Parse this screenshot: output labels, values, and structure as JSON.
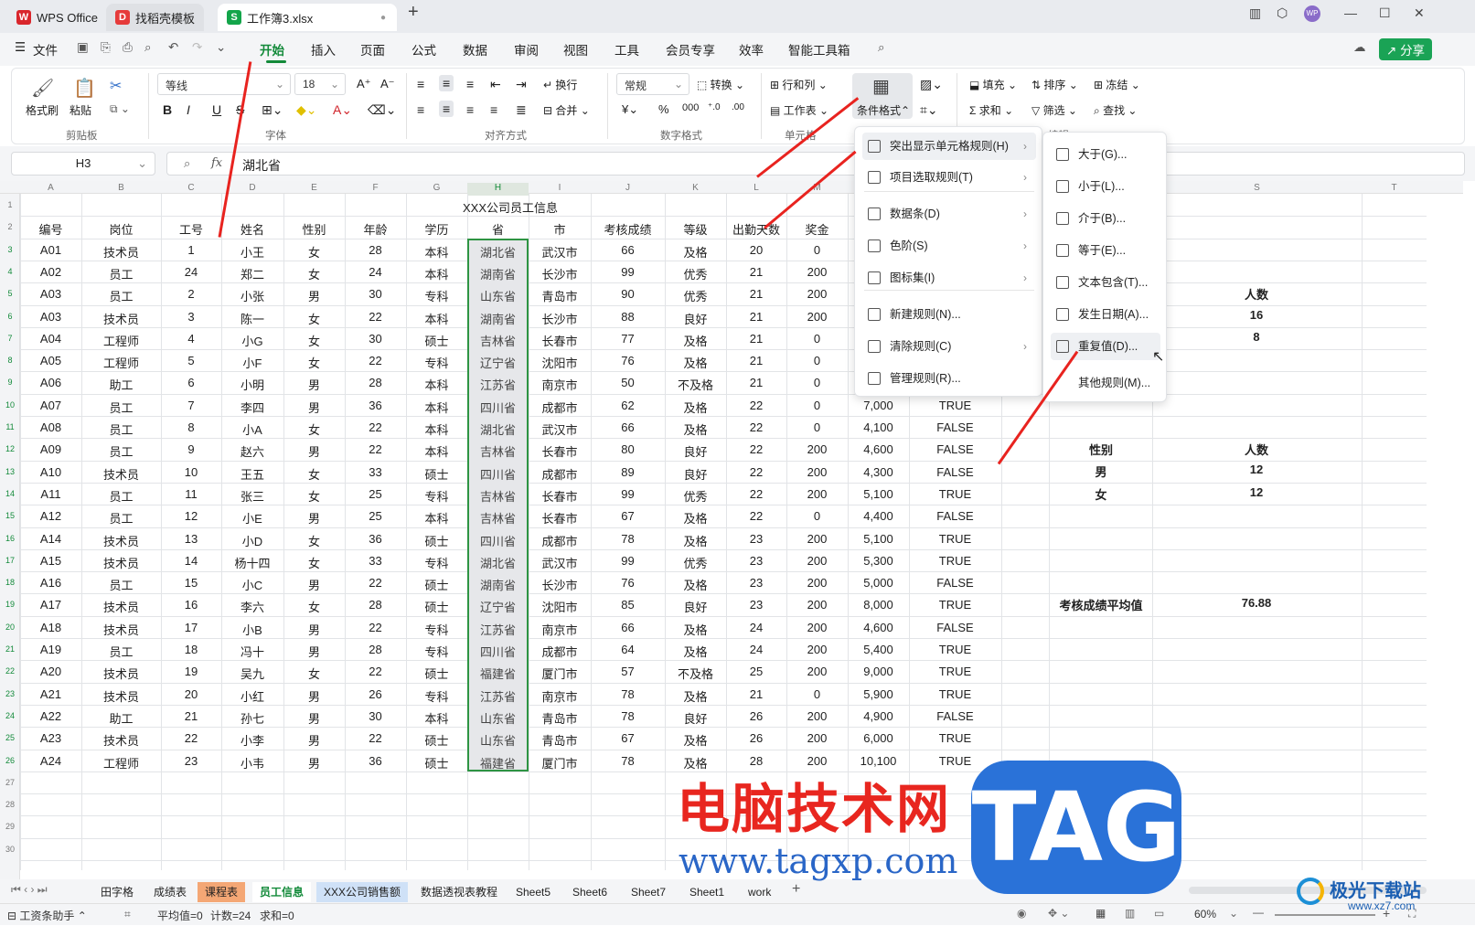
{
  "tabs": [
    {
      "label": "WPS Office"
    },
    {
      "label": "找稻壳模板"
    },
    {
      "label": "工作簿3.xlsx"
    }
  ],
  "menubar": {
    "file": "文件",
    "items": [
      "开始",
      "插入",
      "页面",
      "公式",
      "数据",
      "审阅",
      "视图",
      "工具",
      "会员专享",
      "效率",
      "智能工具箱"
    ],
    "share": "分享"
  },
  "ribbon": {
    "format_painter": "格式刷",
    "paste": "粘贴",
    "group_clipboard": "剪贴板",
    "font_name": "等线",
    "font_size": "18",
    "group_font": "字体",
    "wrap": "换行",
    "merge": "合并",
    "group_align": "对齐方式",
    "number_format": "常规",
    "convert": "转换",
    "group_number": "数字格式",
    "row_col": "行和列",
    "worksheet": "工作表",
    "group_cell": "单元格",
    "cond_format": "条件格式",
    "fill": "填充",
    "sort": "排序",
    "freeze": "冻结",
    "sum": "求和",
    "filter": "筛选",
    "find": "查找",
    "group_edit": "编辑"
  },
  "formula": {
    "cell_ref": "H3",
    "value": "湖北省",
    "fx": "fx"
  },
  "columns": [
    "A",
    "B",
    "C",
    "D",
    "E",
    "F",
    "G",
    "H",
    "I",
    "J",
    "K",
    "L",
    "M",
    "S",
    "T"
  ],
  "sheet_title": "XXX公司员工信息",
  "headers": [
    "编号",
    "岗位",
    "工号",
    "姓名",
    "性别",
    "年龄",
    "学历",
    "省",
    "市",
    "考核成绩",
    "等级",
    "出勤天数",
    "奖金"
  ],
  "rows": [
    [
      "A01",
      "技术员",
      "1",
      "小王",
      "女",
      "28",
      "本科",
      "湖北省",
      "武汉市",
      "66",
      "及格",
      "20",
      "0",
      "",
      ""
    ],
    [
      "A02",
      "员工",
      "24",
      "郑二",
      "女",
      "24",
      "本科",
      "湖南省",
      "长沙市",
      "99",
      "优秀",
      "21",
      "200",
      "",
      ""
    ],
    [
      "A03",
      "员工",
      "2",
      "小张",
      "男",
      "30",
      "专科",
      "山东省",
      "青岛市",
      "90",
      "优秀",
      "21",
      "200",
      "",
      ""
    ],
    [
      "A03",
      "技术员",
      "3",
      "陈一",
      "女",
      "22",
      "本科",
      "湖南省",
      "长沙市",
      "88",
      "良好",
      "21",
      "200",
      "",
      ""
    ],
    [
      "A04",
      "工程师",
      "4",
      "小G",
      "女",
      "30",
      "硕士",
      "吉林省",
      "长春市",
      "77",
      "及格",
      "21",
      "0",
      "",
      ""
    ],
    [
      "A05",
      "工程师",
      "5",
      "小F",
      "女",
      "22",
      "专科",
      "辽宁省",
      "沈阳市",
      "76",
      "及格",
      "21",
      "0",
      "",
      ""
    ],
    [
      "A06",
      "助工",
      "6",
      "小明",
      "男",
      "28",
      "本科",
      "江苏省",
      "南京市",
      "50",
      "不及格",
      "21",
      "0",
      "",
      ""
    ],
    [
      "A07",
      "员工",
      "7",
      "李四",
      "男",
      "36",
      "本科",
      "四川省",
      "成都市",
      "62",
      "及格",
      "22",
      "0",
      "7,000",
      "TRUE"
    ],
    [
      "A08",
      "员工",
      "8",
      "小A",
      "女",
      "22",
      "本科",
      "湖北省",
      "武汉市",
      "66",
      "及格",
      "22",
      "0",
      "4,100",
      "FALSE"
    ],
    [
      "A09",
      "员工",
      "9",
      "赵六",
      "男",
      "22",
      "本科",
      "吉林省",
      "长春市",
      "80",
      "良好",
      "22",
      "200",
      "4,600",
      "FALSE"
    ],
    [
      "A10",
      "技术员",
      "10",
      "王五",
      "女",
      "33",
      "硕士",
      "四川省",
      "成都市",
      "89",
      "良好",
      "22",
      "200",
      "4,300",
      "FALSE"
    ],
    [
      "A11",
      "员工",
      "11",
      "张三",
      "女",
      "25",
      "专科",
      "吉林省",
      "长春市",
      "99",
      "优秀",
      "22",
      "200",
      "5,100",
      "TRUE"
    ],
    [
      "A12",
      "员工",
      "12",
      "小E",
      "男",
      "25",
      "本科",
      "吉林省",
      "长春市",
      "67",
      "及格",
      "22",
      "0",
      "4,400",
      "FALSE"
    ],
    [
      "A14",
      "技术员",
      "13",
      "小D",
      "女",
      "36",
      "硕士",
      "四川省",
      "成都市",
      "78",
      "及格",
      "23",
      "200",
      "5,100",
      "TRUE"
    ],
    [
      "A15",
      "技术员",
      "14",
      "杨十四",
      "女",
      "33",
      "专科",
      "湖北省",
      "武汉市",
      "99",
      "优秀",
      "23",
      "200",
      "5,300",
      "TRUE"
    ],
    [
      "A16",
      "员工",
      "15",
      "小C",
      "男",
      "22",
      "硕士",
      "湖南省",
      "长沙市",
      "76",
      "及格",
      "23",
      "200",
      "5,000",
      "FALSE"
    ],
    [
      "A17",
      "技术员",
      "16",
      "李六",
      "女",
      "28",
      "硕士",
      "辽宁省",
      "沈阳市",
      "85",
      "良好",
      "23",
      "200",
      "8,000",
      "TRUE"
    ],
    [
      "A18",
      "技术员",
      "17",
      "小B",
      "男",
      "22",
      "专科",
      "江苏省",
      "南京市",
      "66",
      "及格",
      "24",
      "200",
      "4,600",
      "FALSE"
    ],
    [
      "A19",
      "员工",
      "18",
      "冯十",
      "男",
      "28",
      "专科",
      "四川省",
      "成都市",
      "64",
      "及格",
      "24",
      "200",
      "5,400",
      "TRUE"
    ],
    [
      "A20",
      "技术员",
      "19",
      "吴九",
      "女",
      "22",
      "硕士",
      "福建省",
      "厦门市",
      "57",
      "不及格",
      "25",
      "200",
      "9,000",
      "TRUE"
    ],
    [
      "A21",
      "技术员",
      "20",
      "小红",
      "男",
      "26",
      "专科",
      "江苏省",
      "南京市",
      "78",
      "及格",
      "21",
      "0",
      "5,900",
      "TRUE"
    ],
    [
      "A22",
      "助工",
      "21",
      "孙七",
      "男",
      "30",
      "本科",
      "山东省",
      "青岛市",
      "78",
      "良好",
      "26",
      "200",
      "4,900",
      "FALSE"
    ],
    [
      "A23",
      "技术员",
      "22",
      "小李",
      "男",
      "22",
      "硕士",
      "山东省",
      "青岛市",
      "67",
      "及格",
      "26",
      "200",
      "6,000",
      "TRUE"
    ],
    [
      "A24",
      "工程师",
      "23",
      "小韦",
      "男",
      "36",
      "硕士",
      "福建省",
      "厦门市",
      "78",
      "及格",
      "28",
      "200",
      "10,100",
      "TRUE"
    ]
  ],
  "side": {
    "count_header": "人数",
    "count1": "16",
    "count2": "8",
    "gender_header": "性别",
    "gender_count_header": "人数",
    "male": "男",
    "male_count": "12",
    "female": "女",
    "female_count": "12",
    "avg_label": "考核成绩平均值",
    "avg_value": "76.88"
  },
  "menu1": [
    {
      "label": "突出显示单元格规则(H)",
      "sub": true
    },
    {
      "label": "项目选取规则(T)",
      "sub": true
    },
    {
      "label": "数据条(D)",
      "sub": true
    },
    {
      "label": "色阶(S)",
      "sub": true
    },
    {
      "label": "图标集(I)",
      "sub": true
    },
    {
      "label": "新建规则(N)...",
      "sub": false
    },
    {
      "label": "清除规则(C)",
      "sub": true
    },
    {
      "label": "管理规则(R)...",
      "sub": false
    }
  ],
  "menu2": [
    "大于(G)...",
    "小于(L)...",
    "介于(B)...",
    "等于(E)...",
    "文本包含(T)...",
    "发生日期(A)...",
    "重复值(D)...",
    "其他规则(M)..."
  ],
  "sheets": [
    "田字格",
    "成绩表",
    "课程表",
    "员工信息",
    "XXX公司销售额",
    "数据透视表教程",
    "Sheet5",
    "Sheet6",
    "Sheet7",
    "Sheet1",
    "work"
  ],
  "status": {
    "assistant": "工资条助手",
    "avg": "平均值=0",
    "count": "计数=24",
    "sum": "求和=0",
    "zoom": "60%"
  },
  "watermark": {
    "site": "电脑技术网",
    "tag": "TAG",
    "url": "www.tagxp.com",
    "logo": "极光下载站",
    "logo_url": "www.xz7.com"
  }
}
